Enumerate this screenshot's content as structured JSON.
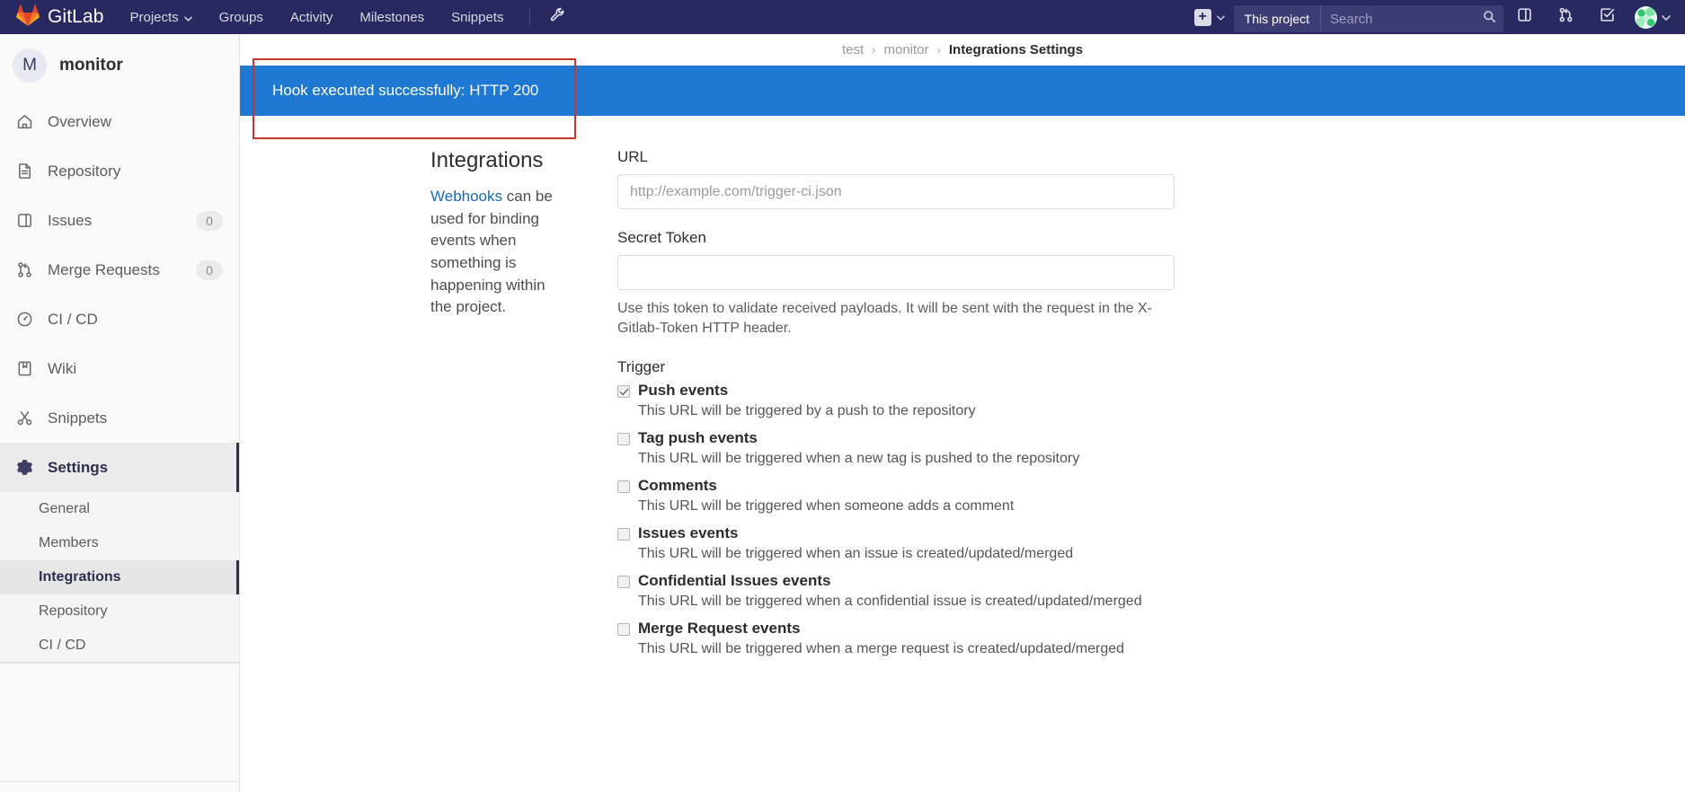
{
  "navbar": {
    "brand": "GitLab",
    "brand_icon": "gitlab-logo-icon",
    "links": [
      {
        "label": "Projects",
        "has_caret": true
      },
      {
        "label": "Groups",
        "has_caret": false
      },
      {
        "label": "Activity",
        "has_caret": false
      },
      {
        "label": "Milestones",
        "has_caret": false
      },
      {
        "label": "Snippets",
        "has_caret": false
      }
    ],
    "wrench_icon": "wrench-icon",
    "plus_label": "+",
    "search_scope": "This project",
    "search_placeholder": "Search",
    "search_value": "",
    "icons": [
      {
        "name": "issues-icon"
      },
      {
        "name": "merge-requests-icon"
      },
      {
        "name": "todos-icon"
      }
    ],
    "avatar_name": "user-avatar"
  },
  "sidebar": {
    "project_initial": "M",
    "project_name": "monitor",
    "items": [
      {
        "label": "Overview",
        "icon": "home-icon",
        "badge": null
      },
      {
        "label": "Repository",
        "icon": "document-icon",
        "badge": null
      },
      {
        "label": "Issues",
        "icon": "issues-icon",
        "badge": "0"
      },
      {
        "label": "Merge Requests",
        "icon": "merge-request-icon",
        "badge": "0"
      },
      {
        "label": "CI / CD",
        "icon": "rocket-icon",
        "badge": null
      },
      {
        "label": "Wiki",
        "icon": "book-icon",
        "badge": null
      },
      {
        "label": "Snippets",
        "icon": "scissors-icon",
        "badge": null
      },
      {
        "label": "Settings",
        "icon": "gear-icon",
        "badge": null,
        "active": true
      }
    ],
    "subitems": [
      {
        "label": "General",
        "active": false
      },
      {
        "label": "Members",
        "active": false
      },
      {
        "label": "Integrations",
        "active": true
      },
      {
        "label": "Repository",
        "active": false
      },
      {
        "label": "CI / CD",
        "active": false
      }
    ]
  },
  "breadcrumb": {
    "items": [
      "test",
      "monitor"
    ],
    "current": "Integrations Settings",
    "separator": "›"
  },
  "alert": {
    "message": "Hook executed successfully: HTTP 200",
    "background_color": "#1f78d1",
    "text_color": "#ffffff"
  },
  "annotation": {
    "border_color": "#c0392b"
  },
  "integrations": {
    "title": "Integrations",
    "desc_link": "Webhooks",
    "desc_rest": " can be used for binding events when something is happening within the project."
  },
  "form": {
    "url_label": "URL",
    "url_placeholder": "http://example.com/trigger-ci.json",
    "url_value": "",
    "secret_label": "Secret Token",
    "secret_placeholder": "",
    "secret_value": "",
    "secret_help": "Use this token to validate received payloads. It will be sent with the request in the X-Gitlab-Token HTTP header.",
    "trigger_label": "Trigger",
    "triggers": [
      {
        "name": "Push events",
        "desc": "This URL will be triggered by a push to the repository",
        "checked": true
      },
      {
        "name": "Tag push events",
        "desc": "This URL will be triggered when a new tag is pushed to the repository",
        "checked": false
      },
      {
        "name": "Comments",
        "desc": "This URL will be triggered when someone adds a comment",
        "checked": false
      },
      {
        "name": "Issues events",
        "desc": "This URL will be triggered when an issue is created/updated/merged",
        "checked": false
      },
      {
        "name": "Confidential Issues events",
        "desc": "This URL will be triggered when a confidential issue is created/updated/merged",
        "checked": false
      },
      {
        "name": "Merge Request events",
        "desc": "This URL will be triggered when a merge request is created/updated/merged",
        "checked": false
      }
    ]
  }
}
